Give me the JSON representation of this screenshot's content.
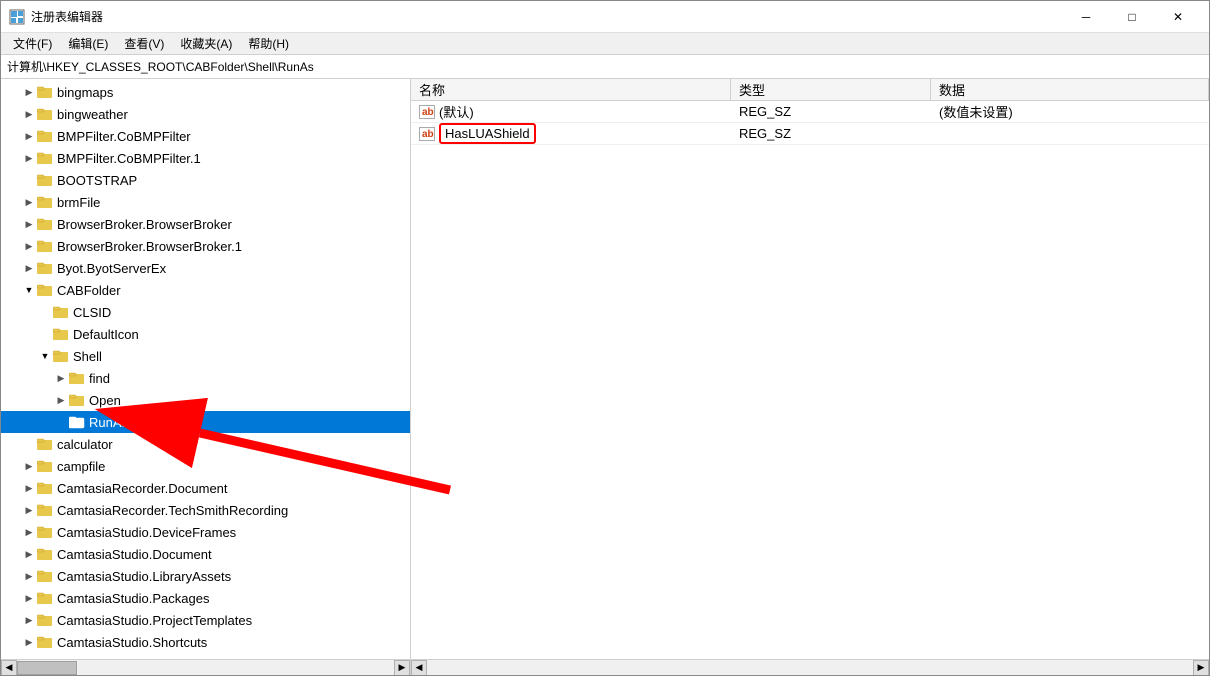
{
  "window": {
    "title": "注册表编辑器",
    "min_label": "─",
    "max_label": "□",
    "close_label": "✕"
  },
  "menu": {
    "items": [
      "文件(F)",
      "编辑(E)",
      "查看(V)",
      "收藏夹(A)",
      "帮助(H)"
    ]
  },
  "breadcrumb": "计算机\\HKEY_CLASSES_ROOT\\CABFolder\\Shell\\RunAs",
  "left_pane": {
    "items": [
      {
        "id": "bingmaps",
        "label": "bingmaps",
        "indent": 1,
        "expanded": false,
        "has_children": true
      },
      {
        "id": "bingweather",
        "label": "bingweather",
        "indent": 1,
        "expanded": false,
        "has_children": true
      },
      {
        "id": "bmpfilter-cobmpfilter",
        "label": "BMPFilter.CoBMPFilter",
        "indent": 1,
        "expanded": false,
        "has_children": true
      },
      {
        "id": "bmpfilter-cobmpfilter1",
        "label": "BMPFilter.CoBMPFilter.1",
        "indent": 1,
        "expanded": false,
        "has_children": true
      },
      {
        "id": "bootstrap",
        "label": "BOOTSTRAP",
        "indent": 1,
        "expanded": false,
        "has_children": false
      },
      {
        "id": "brmfile",
        "label": "brmFile",
        "indent": 1,
        "expanded": false,
        "has_children": true
      },
      {
        "id": "browserbroker",
        "label": "BrowserBroker.BrowserBroker",
        "indent": 1,
        "expanded": false,
        "has_children": true
      },
      {
        "id": "browserbroker1",
        "label": "BrowserBroker.BrowserBroker.1",
        "indent": 1,
        "expanded": false,
        "has_children": true
      },
      {
        "id": "byot",
        "label": "Byot.ByotServerEx",
        "indent": 1,
        "expanded": false,
        "has_children": true
      },
      {
        "id": "cabfolder",
        "label": "CABFolder",
        "indent": 1,
        "expanded": true,
        "has_children": true
      },
      {
        "id": "clsid",
        "label": "CLSID",
        "indent": 2,
        "expanded": false,
        "has_children": false
      },
      {
        "id": "defaulticon",
        "label": "DefaultIcon",
        "indent": 2,
        "expanded": false,
        "has_children": false
      },
      {
        "id": "shell",
        "label": "Shell",
        "indent": 2,
        "expanded": true,
        "has_children": true
      },
      {
        "id": "find",
        "label": "find",
        "indent": 3,
        "expanded": false,
        "has_children": true
      },
      {
        "id": "open",
        "label": "Open",
        "indent": 3,
        "expanded": false,
        "has_children": true
      },
      {
        "id": "runas",
        "label": "RunAs",
        "indent": 3,
        "expanded": false,
        "has_children": false,
        "selected": true
      },
      {
        "id": "calculator",
        "label": "calculator",
        "indent": 1,
        "expanded": false,
        "has_children": false
      },
      {
        "id": "campfile",
        "label": "campfile",
        "indent": 1,
        "expanded": false,
        "has_children": true
      },
      {
        "id": "camtasiarecorder-document",
        "label": "CamtasiaRecorder.Document",
        "indent": 1,
        "expanded": false,
        "has_children": true
      },
      {
        "id": "camtasiarecorder-techsmithrecording",
        "label": "CamtasiaRecorder.TechSmithRecording",
        "indent": 1,
        "expanded": false,
        "has_children": true
      },
      {
        "id": "camtasiastudio-deviceframes",
        "label": "CamtasiaStudio.DeviceFrames",
        "indent": 1,
        "expanded": false,
        "has_children": true
      },
      {
        "id": "camtasiastudio-document",
        "label": "CamtasiaStudio.Document",
        "indent": 1,
        "expanded": false,
        "has_children": true
      },
      {
        "id": "camtasiastudio-libraryassets",
        "label": "CamtasiaStudio.LibraryAssets",
        "indent": 1,
        "expanded": false,
        "has_children": true
      },
      {
        "id": "camtasiastudio-packages",
        "label": "CamtasiaStudio.Packages",
        "indent": 1,
        "expanded": false,
        "has_children": true
      },
      {
        "id": "camtasiastudio-projecttemplates",
        "label": "CamtasiaStudio.ProjectTemplates",
        "indent": 1,
        "expanded": false,
        "has_children": true
      },
      {
        "id": "camtasiastudio-shortcuts",
        "label": "CamtasiaStudio.Shortcuts",
        "indent": 1,
        "expanded": false,
        "has_children": true
      }
    ]
  },
  "right_pane": {
    "columns": [
      "名称",
      "类型",
      "数据"
    ],
    "rows": [
      {
        "name": "(默认)",
        "type": "REG_SZ",
        "data": "(数值未设置)",
        "icon": "ab"
      },
      {
        "name": "HasLUAShield",
        "type": "REG_SZ",
        "data": "",
        "icon": "ab",
        "highlighted": true
      }
    ]
  },
  "icons": {
    "folder": "📁",
    "ab_icon": "ab"
  }
}
